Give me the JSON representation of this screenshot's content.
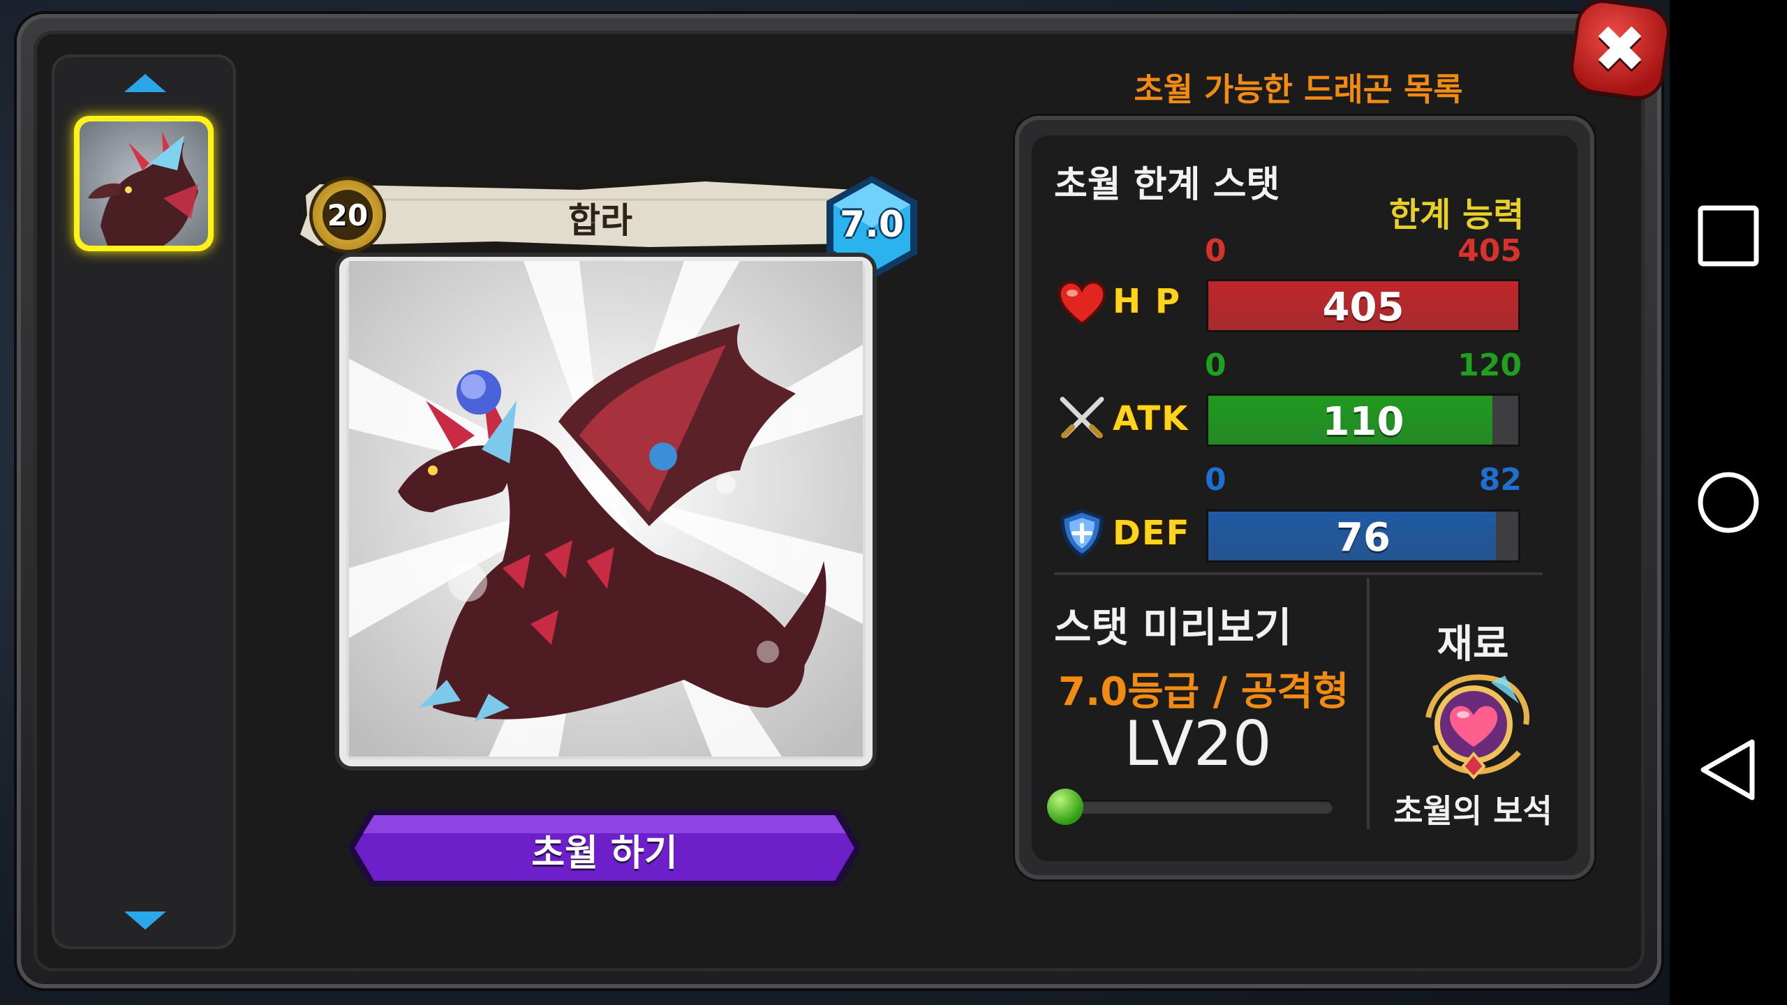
{
  "list": {
    "selected_item": "dragon-thumb"
  },
  "dialog": {
    "list_title": "초월 가능한 드래곤 목록",
    "close_label": "✖"
  },
  "card": {
    "level": "20",
    "name": "합라",
    "grade": "7.0",
    "action_button": "초월 하기"
  },
  "stats": {
    "title": "초월 한계 스탯",
    "subtitle": "한계 능력",
    "rows": [
      {
        "label": "H P",
        "icon": "heart-icon",
        "min": "0",
        "max": "405",
        "value": "405",
        "fraction": 1.0,
        "color": "#c0262a",
        "accent": "#c0262a"
      },
      {
        "label": "ATK",
        "icon": "crossed-swords-icon",
        "min": "0",
        "max": "120",
        "value": "110",
        "fraction": 0.917,
        "color": "#1f9a1f",
        "accent": "#1fa01f"
      },
      {
        "label": "DEF",
        "icon": "shield-icon",
        "min": "0",
        "max": "82",
        "value": "76",
        "fraction": 0.927,
        "color": "#1e5aa3",
        "accent": "#1e6fd0"
      }
    ]
  },
  "preview": {
    "title": "스탯 미리보기",
    "grade_line": "7.0등급 / 공격형",
    "level": "LV20",
    "exp_fraction": 0.0
  },
  "material": {
    "title": "재료",
    "name": "초월의 보석",
    "icon": "gem-icon"
  },
  "navbar": {
    "recent": "square-icon",
    "home": "circle-icon",
    "back": "triangle-back-icon"
  }
}
